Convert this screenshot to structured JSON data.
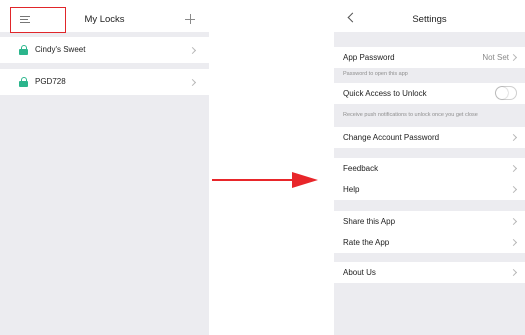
{
  "left": {
    "title": "My Locks",
    "locks": [
      {
        "name": "Cindy's Sweet"
      },
      {
        "name": "PGD728"
      }
    ]
  },
  "right": {
    "title": "Settings",
    "app_password": {
      "label": "App Password",
      "value": "Not Set",
      "hint": "Password to open this app"
    },
    "quick_access": {
      "label": "Quick Access to Unlock",
      "hint": "Receive push notifications to unlock once you get close",
      "enabled": false
    },
    "change_password": {
      "label": "Change Account Password"
    },
    "feedback": {
      "label": "Feedback"
    },
    "help": {
      "label": "Help"
    },
    "share": {
      "label": "Share this App"
    },
    "rate": {
      "label": "Rate the App"
    },
    "about": {
      "label": "About Us"
    }
  },
  "colors": {
    "accent_green": "#2bb58c",
    "highlight_red": "#e0262a",
    "arrow_red": "#e8262a",
    "background_gray": "#ececf0"
  },
  "icons": [
    "menu-icon",
    "add-icon",
    "lock-icon",
    "chevron-right-icon",
    "back-icon",
    "arrow-right-icon"
  ]
}
